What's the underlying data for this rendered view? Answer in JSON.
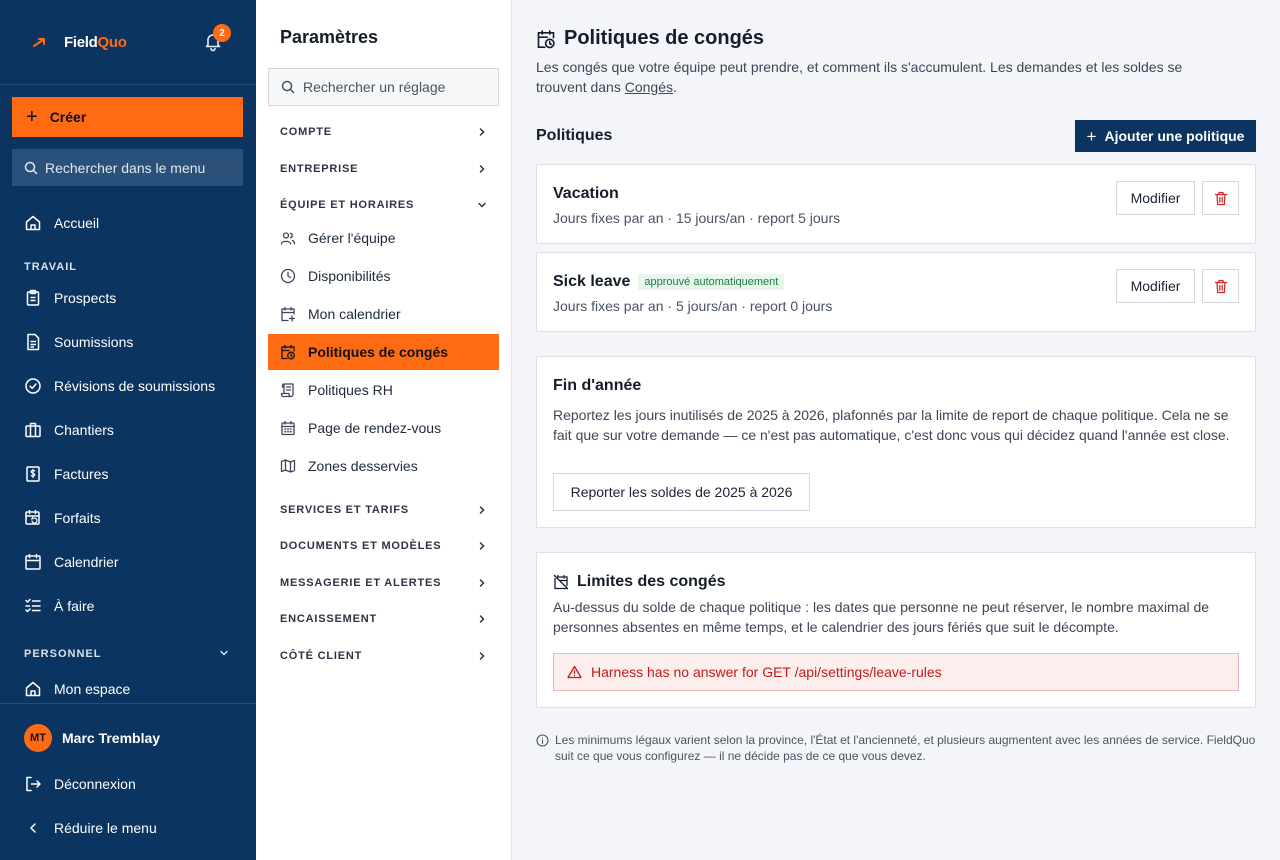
{
  "app": {
    "brand_first": "Field",
    "brand_second": "Quo",
    "notification_count": "2",
    "accent_color": "#ff6b12",
    "sidebar_color": "#0c3460"
  },
  "sidebar": {
    "create_label": "Créer",
    "search_placeholder": "Rechercher dans le menu",
    "home_label": "Accueil",
    "section_work": "TRAVAIL",
    "work_items": [
      {
        "label": "Prospects",
        "icon": "clipboard-icon"
      },
      {
        "label": "Soumissions",
        "icon": "document-icon"
      },
      {
        "label": "Révisions de soumissions",
        "icon": "check-circle-icon"
      },
      {
        "label": "Chantiers",
        "icon": "briefcase-icon"
      },
      {
        "label": "Factures",
        "icon": "invoice-icon"
      },
      {
        "label": "Forfaits",
        "icon": "calendar-repeat-icon"
      },
      {
        "label": "Calendrier",
        "icon": "calendar-icon"
      },
      {
        "label": "À faire",
        "icon": "checklist-icon"
      }
    ],
    "section_personal": "PERSONNEL",
    "my_space_label": "Mon espace",
    "user_initials": "MT",
    "user_name": "Marc Tremblay",
    "logout_label": "Déconnexion",
    "collapse_label": "Réduire le menu"
  },
  "settings": {
    "title": "Paramètres",
    "search_placeholder": "Rechercher un réglage",
    "groups_top": [
      "COMPTE",
      "ENTREPRISE"
    ],
    "open_group": "ÉQUIPE ET HORAIRES",
    "open_group_items": [
      {
        "label": "Gérer l'équipe",
        "icon": "users-icon"
      },
      {
        "label": "Disponibilités",
        "icon": "clock-icon"
      },
      {
        "label": "Mon calendrier",
        "icon": "calendar-plus-icon"
      },
      {
        "label": "Politiques de congés",
        "icon": "calendar-clock-icon"
      },
      {
        "label": "Politiques RH",
        "icon": "scroll-icon"
      },
      {
        "label": "Page de rendez-vous",
        "icon": "calendar-grid-icon"
      },
      {
        "label": "Zones desservies",
        "icon": "map-icon"
      }
    ],
    "groups_bottom": [
      "SERVICES ET TARIFS",
      "DOCUMENTS ET MODÈLES",
      "MESSAGERIE ET ALERTES",
      "ENCAISSEMENT",
      "CÔTÉ CLIENT"
    ]
  },
  "main": {
    "title": "Politiques de congés",
    "desc_before": "Les congés que votre équipe peut prendre, et comment ils s'accumulent. Les demandes et les soldes se trouvent dans ",
    "desc_link": "Congés",
    "desc_after": ".",
    "policies_label": "Politiques",
    "add_policy_label": "Ajouter une politique",
    "policies": [
      {
        "name": "Vacation",
        "badge": "",
        "meta": "Jours fixes par an · 15 jours/an · report 5 jours"
      },
      {
        "name": "Sick leave",
        "badge": "approuvé automatiquement",
        "meta": "Jours fixes par an · 5 jours/an · report 0 jours"
      }
    ],
    "edit_label": "Modifier",
    "year_end": {
      "title": "Fin d'année",
      "text": "Reportez les jours inutilisés de 2025 à 2026, plafonnés par la limite de report de chaque politique. Cela ne se fait que sur votre demande — ce n'est pas automatique, c'est donc vous qui décidez quand l'année est close.",
      "button": "Reporter les soldes de 2025 à 2026"
    },
    "limits": {
      "title": "Limites des congés",
      "text": "Au-dessus du solde de chaque politique : les dates que personne ne peut réserver, le nombre maximal de personnes absentes en même temps, et le calendrier des jours fériés que suit le décompte.",
      "error": "Harness has no answer for GET /api/settings/leave-rules"
    },
    "footnote": "Les minimums légaux varient selon la province, l'État et l'ancienneté, et plusieurs augmentent avec les années de service. FieldQuo suit ce que vous configurez — il ne décide pas de ce que vous devez."
  }
}
